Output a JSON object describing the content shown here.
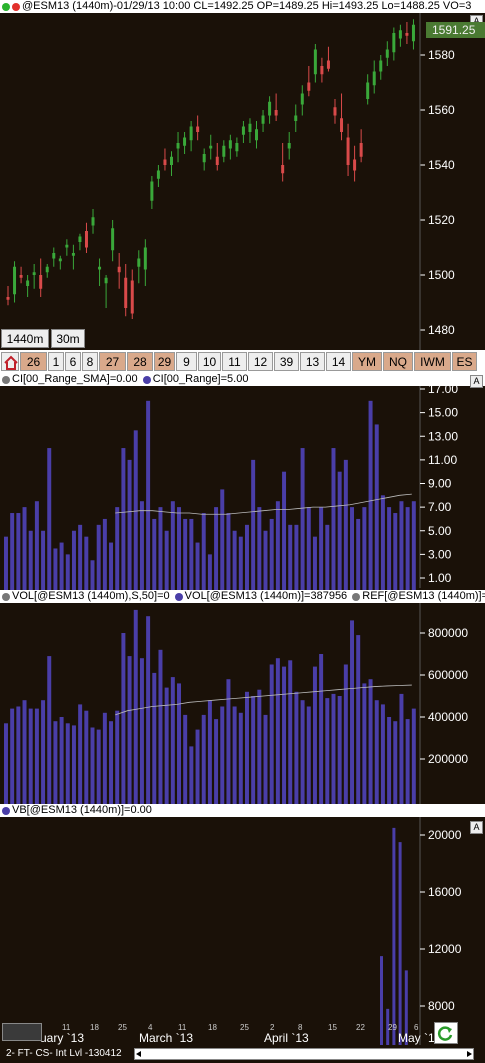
{
  "price": {
    "header": "@ESM13 (1440m)-01/29/13 10:00 CL=1492.25 OP=1489.25 Hi=1493.25 Lo=1488.25 VO=3",
    "last_price": "1591.25",
    "y_ticks": [
      "1580",
      "1560",
      "1540",
      "1520",
      "1500",
      "1480"
    ],
    "timeframes": [
      "1440m",
      "30m"
    ],
    "symbols": [
      "26",
      "1",
      "6",
      "8",
      "27",
      "28",
      "29",
      "9",
      "10",
      "11",
      "12",
      "39",
      "13",
      "14",
      "YM",
      "NQ",
      "IWM",
      "ES"
    ],
    "candles": [
      {
        "o": 1492,
        "h": 1496,
        "l": 1489,
        "c": 1491
      },
      {
        "o": 1493,
        "h": 1505,
        "l": 1490,
        "c": 1503
      },
      {
        "o": 1500,
        "h": 1503,
        "l": 1497,
        "c": 1499
      },
      {
        "o": 1496,
        "h": 1500,
        "l": 1492,
        "c": 1498
      },
      {
        "o": 1500,
        "h": 1504,
        "l": 1495,
        "c": 1501
      },
      {
        "o": 1500,
        "h": 1506,
        "l": 1492,
        "c": 1495
      },
      {
        "o": 1501,
        "h": 1504,
        "l": 1499,
        "c": 1503
      },
      {
        "o": 1506,
        "h": 1510,
        "l": 1503,
        "c": 1508
      },
      {
        "o": 1505,
        "h": 1507,
        "l": 1502,
        "c": 1506
      },
      {
        "o": 1510,
        "h": 1513,
        "l": 1507,
        "c": 1511
      },
      {
        "o": 1507,
        "h": 1511,
        "l": 1502,
        "c": 1508
      },
      {
        "o": 1512,
        "h": 1515,
        "l": 1509,
        "c": 1514
      },
      {
        "o": 1516,
        "h": 1519,
        "l": 1508,
        "c": 1510
      },
      {
        "o": 1518,
        "h": 1524,
        "l": 1515,
        "c": 1521
      },
      {
        "o": 1502,
        "h": 1506,
        "l": 1496,
        "c": 1503
      },
      {
        "o": 1497,
        "h": 1500,
        "l": 1488,
        "c": 1499
      },
      {
        "o": 1509,
        "h": 1520,
        "l": 1505,
        "c": 1517
      },
      {
        "o": 1503,
        "h": 1508,
        "l": 1495,
        "c": 1501
      },
      {
        "o": 1499,
        "h": 1504,
        "l": 1485,
        "c": 1488
      },
      {
        "o": 1498,
        "h": 1502,
        "l": 1484,
        "c": 1486
      },
      {
        "o": 1503,
        "h": 1509,
        "l": 1497,
        "c": 1506
      },
      {
        "o": 1502,
        "h": 1513,
        "l": 1496,
        "c": 1510
      },
      {
        "o": 1527,
        "h": 1536,
        "l": 1524,
        "c": 1534
      },
      {
        "o": 1535,
        "h": 1540,
        "l": 1532,
        "c": 1538
      },
      {
        "o": 1542,
        "h": 1546,
        "l": 1538,
        "c": 1540
      },
      {
        "o": 1540,
        "h": 1545,
        "l": 1536,
        "c": 1543
      },
      {
        "o": 1546,
        "h": 1552,
        "l": 1541,
        "c": 1548
      },
      {
        "o": 1547,
        "h": 1552,
        "l": 1544,
        "c": 1550
      },
      {
        "o": 1549,
        "h": 1556,
        "l": 1545,
        "c": 1554
      },
      {
        "o": 1554,
        "h": 1558,
        "l": 1549,
        "c": 1552
      },
      {
        "o": 1541,
        "h": 1546,
        "l": 1538,
        "c": 1544
      },
      {
        "o": 1546,
        "h": 1551,
        "l": 1542,
        "c": 1547
      },
      {
        "o": 1543,
        "h": 1548,
        "l": 1538,
        "c": 1540
      },
      {
        "o": 1543,
        "h": 1549,
        "l": 1541,
        "c": 1547
      },
      {
        "o": 1546,
        "h": 1551,
        "l": 1542,
        "c": 1549
      },
      {
        "o": 1545,
        "h": 1550,
        "l": 1543,
        "c": 1548
      },
      {
        "o": 1551,
        "h": 1556,
        "l": 1548,
        "c": 1554
      },
      {
        "o": 1552,
        "h": 1557,
        "l": 1548,
        "c": 1555
      },
      {
        "o": 1549,
        "h": 1556,
        "l": 1546,
        "c": 1553
      },
      {
        "o": 1555,
        "h": 1560,
        "l": 1552,
        "c": 1558
      },
      {
        "o": 1558,
        "h": 1565,
        "l": 1555,
        "c": 1563
      },
      {
        "o": 1560,
        "h": 1566,
        "l": 1556,
        "c": 1558
      },
      {
        "o": 1540,
        "h": 1548,
        "l": 1534,
        "c": 1537
      },
      {
        "o": 1546,
        "h": 1552,
        "l": 1542,
        "c": 1548
      },
      {
        "o": 1556,
        "h": 1562,
        "l": 1552,
        "c": 1558
      },
      {
        "o": 1562,
        "h": 1569,
        "l": 1558,
        "c": 1566
      },
      {
        "o": 1570,
        "h": 1576,
        "l": 1565,
        "c": 1567
      },
      {
        "o": 1573,
        "h": 1584,
        "l": 1570,
        "c": 1582
      },
      {
        "o": 1576,
        "h": 1579,
        "l": 1570,
        "c": 1573
      },
      {
        "o": 1578,
        "h": 1583,
        "l": 1574,
        "c": 1575
      },
      {
        "o": 1561,
        "h": 1564,
        "l": 1555,
        "c": 1558
      },
      {
        "o": 1557,
        "h": 1566,
        "l": 1549,
        "c": 1552
      },
      {
        "o": 1550,
        "h": 1555,
        "l": 1536,
        "c": 1540
      },
      {
        "o": 1542,
        "h": 1547,
        "l": 1534,
        "c": 1538
      },
      {
        "o": 1548,
        "h": 1553,
        "l": 1541,
        "c": 1543
      },
      {
        "o": 1564,
        "h": 1573,
        "l": 1562,
        "c": 1570
      },
      {
        "o": 1569,
        "h": 1578,
        "l": 1566,
        "c": 1574
      },
      {
        "o": 1574,
        "h": 1580,
        "l": 1571,
        "c": 1578
      },
      {
        "o": 1579,
        "h": 1585,
        "l": 1576,
        "c": 1582
      },
      {
        "o": 1581,
        "h": 1590,
        "l": 1578,
        "c": 1588
      },
      {
        "o": 1586,
        "h": 1591,
        "l": 1583,
        "c": 1589
      },
      {
        "o": 1588,
        "h": 1592,
        "l": 1584,
        "c": 1587
      },
      {
        "o": 1585,
        "h": 1593,
        "l": 1582,
        "c": 1591
      }
    ]
  },
  "ci": {
    "header_a": "CI[00_Range_SMA]=0.00",
    "header_b": "CI[00_Range]=5.00",
    "y_ticks": [
      "17.00",
      "15.00",
      "13.00",
      "11.00",
      "9.00",
      "7.00",
      "5.00",
      "3.00",
      "1.00"
    ],
    "values": [
      4.5,
      6.5,
      6.5,
      7,
      5,
      7.5,
      5,
      12,
      3.5,
      4,
      3,
      5,
      5.5,
      4.5,
      2.5,
      5.5,
      6,
      4,
      7,
      12,
      11,
      13.5,
      7.5,
      16,
      6,
      7,
      5,
      7.5,
      7,
      6,
      6,
      4,
      6.5,
      3,
      7,
      8.5,
      6.5,
      5,
      4.5,
      5.5,
      11,
      7,
      5,
      6,
      7.5,
      10,
      5.5,
      5.5,
      12,
      7,
      4.5,
      7,
      5.5,
      12,
      10,
      11,
      7,
      6,
      7,
      16,
      14,
      8,
      7,
      6.5,
      7.5,
      7,
      7.5
    ],
    "sma": [
      6.5,
      6.6,
      6.7,
      6.7,
      6.6,
      6.5,
      6.5,
      6.4,
      6.4,
      6.4,
      6.5,
      6.6,
      6.7,
      6.8,
      6.8,
      6.9,
      7,
      7,
      7.1,
      7.2,
      7.4,
      7.6,
      7.8,
      8,
      8.1
    ]
  },
  "vol": {
    "header_a": "VOL[@ESM13 (1440m),S,50]=0",
    "header_b": "VOL[@ESM13 (1440m)]=387956",
    "header_c": "REF[@ESM13 (1440m)]=",
    "y_ticks": [
      "800000",
      "600000",
      "400000",
      "200000"
    ],
    "values": [
      370000,
      440000,
      450000,
      480000,
      440000,
      440000,
      480000,
      690000,
      380000,
      400000,
      370000,
      360000,
      460000,
      430000,
      350000,
      340000,
      420000,
      380000,
      430000,
      800000,
      690000,
      910000,
      680000,
      880000,
      610000,
      720000,
      540000,
      590000,
      560000,
      410000,
      260000,
      340000,
      410000,
      480000,
      390000,
      450000,
      580000,
      450000,
      420000,
      520000,
      500000,
      530000,
      410000,
      650000,
      680000,
      640000,
      670000,
      520000,
      480000,
      450000,
      640000,
      700000,
      490000,
      510000,
      500000,
      650000,
      860000,
      790000,
      560000,
      580000,
      480000,
      460000,
      400000,
      380000,
      510000,
      390000,
      440000
    ],
    "sma": [
      410000,
      430000,
      440000,
      450000,
      455000,
      460000,
      470000,
      475000,
      480000,
      485000,
      490000,
      495000,
      500000,
      505000,
      510000,
      515000,
      520000,
      525000,
      530000,
      535000,
      540000,
      545000,
      548000,
      550000,
      552000
    ]
  },
  "vb": {
    "header": "VB[@ESM13 (1440m)]=0.00",
    "y_ticks": [
      "20000",
      "16000",
      "12000",
      "8000"
    ],
    "bars": [
      {
        "i": 0,
        "v": 11500
      },
      {
        "i": 1,
        "v": 7800
      },
      {
        "i": 2,
        "v": 20500
      },
      {
        "i": 3,
        "v": 19500
      },
      {
        "i": 4,
        "v": 10500
      }
    ]
  },
  "x_axis": {
    "labels": [
      "uary `13",
      "March `13",
      "April `13",
      "May `1"
    ],
    "ticks": [
      "11",
      "18",
      "25",
      "4",
      "11",
      "18",
      "25",
      "2",
      "8",
      "15",
      "22",
      "29",
      "6"
    ]
  },
  "status": {
    "text": "2- FT- CS- Int Lvl -130412"
  }
}
